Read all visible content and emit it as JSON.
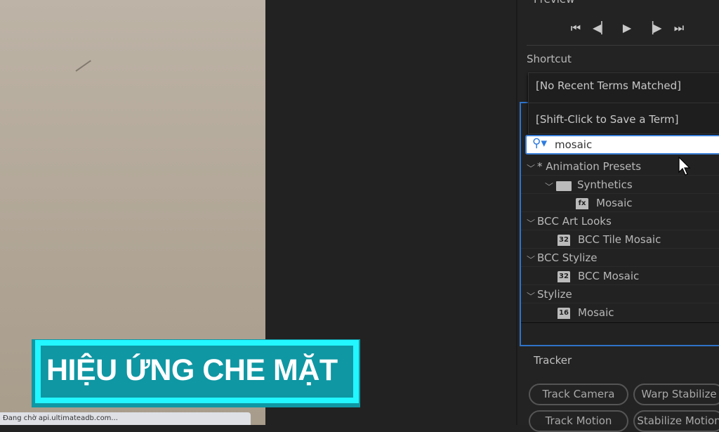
{
  "preview": {
    "title": "Preview",
    "controls": [
      {
        "name": "first-frame",
        "glyph": "⏮"
      },
      {
        "name": "previous-frame",
        "glyph": "⏴|"
      },
      {
        "name": "play",
        "glyph": "▶"
      },
      {
        "name": "next-frame",
        "glyph": "|⏵"
      },
      {
        "name": "last-frame",
        "glyph": "⏭"
      }
    ]
  },
  "shortcut": {
    "label": "Shortcut",
    "dropdown": [
      "[No Recent Terms Matched]",
      "[Shift-Click to Save a Term]"
    ]
  },
  "search": {
    "value": "mosaic"
  },
  "tree": [
    {
      "label": "* Animation Presets",
      "level": 0,
      "type": "group"
    },
    {
      "label": "Synthetics",
      "level": 1,
      "type": "folder"
    },
    {
      "label": "Mosaic",
      "level": 2,
      "type": "preset",
      "badge": "fx"
    },
    {
      "label": "BCC Art Looks",
      "level": 0,
      "type": "group"
    },
    {
      "label": "BCC Tile Mosaic",
      "level": 1,
      "type": "effect",
      "badge": "32"
    },
    {
      "label": "BCC Stylize",
      "level": 0,
      "type": "group"
    },
    {
      "label": "BCC Mosaic",
      "level": 1,
      "type": "effect",
      "badge": "32"
    },
    {
      "label": "Stylize",
      "level": 0,
      "type": "group"
    },
    {
      "label": "Mosaic",
      "level": 1,
      "type": "effect",
      "badge": "16"
    }
  ],
  "tracker": {
    "title": "Tracker",
    "buttons": [
      "Track Camera",
      "Warp Stabilize",
      "Track Motion",
      "Stabilize Motion"
    ]
  },
  "overlay": {
    "title": "HIỆU ỨNG CHE MẶT",
    "accent": "#22f6ff"
  },
  "status_bar": "Đang chờ api.ultimateadb.com..."
}
